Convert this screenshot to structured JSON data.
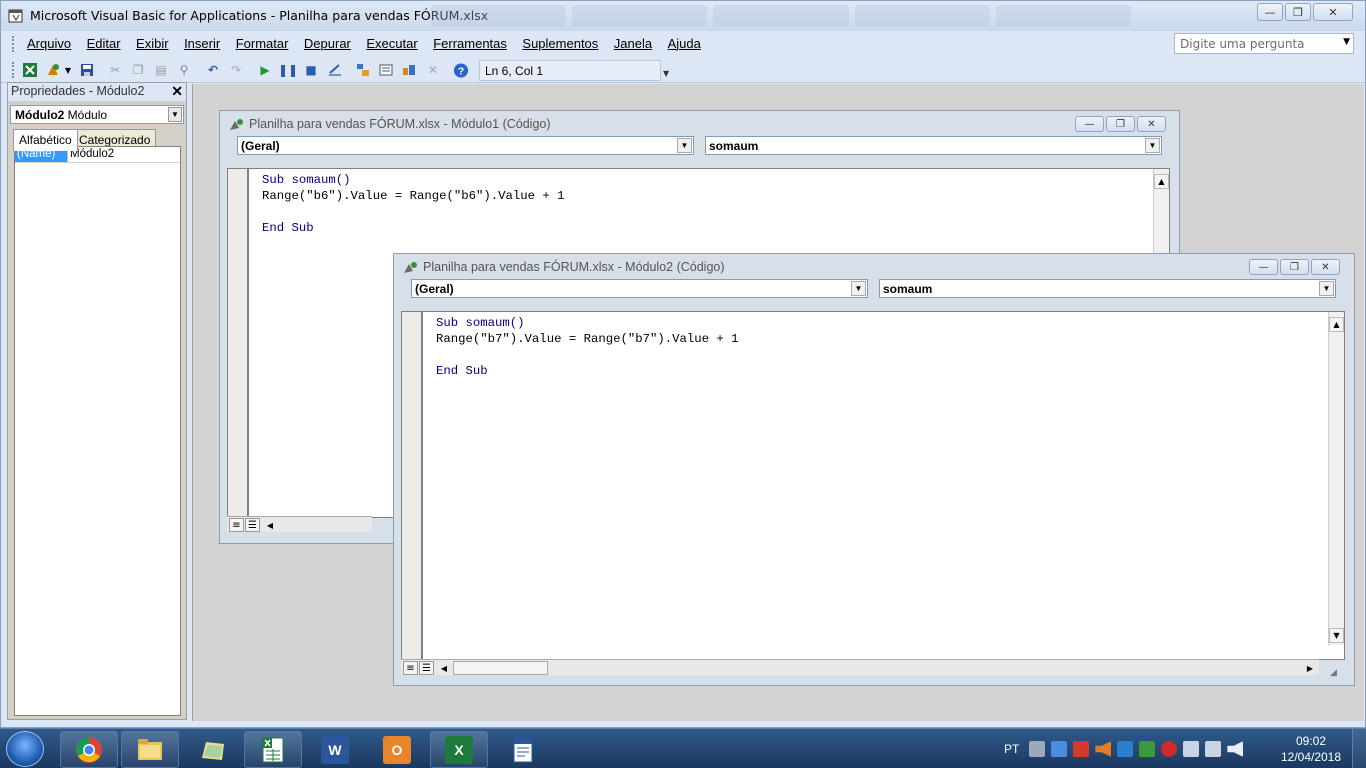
{
  "window": {
    "title": "Microsoft Visual Basic for Applications - Planilha para vendas  FÓRUM.xlsx",
    "controls": [
      "—",
      "❐",
      "✕"
    ]
  },
  "menu": {
    "items": [
      "Arquivo",
      "Editar",
      "Exibir",
      "Inserir",
      "Formatar",
      "Depurar",
      "Executar",
      "Ferramentas",
      "Suplementos",
      "Janela",
      "Ajuda"
    ]
  },
  "help": {
    "placeholder": "Digite uma pergunta"
  },
  "toolbar": {
    "position": "Ln 6, Col 1",
    "icons": [
      "excel-view-icon",
      "insert-module-icon",
      "save-icon",
      "cut-icon",
      "copy-icon",
      "paste-icon",
      "find-icon",
      "undo-icon",
      "redo-icon",
      "run-icon",
      "break-icon",
      "reset-icon",
      "design-mode-icon",
      "project-explorer-icon",
      "properties-window-icon",
      "object-browser-icon",
      "toolbox-icon",
      "help-icon"
    ]
  },
  "properties": {
    "title": "Propriedades - Módulo2",
    "object_name": "Módulo2",
    "object_type": "Módulo",
    "tabs": [
      "Alfabético",
      "Categorizado"
    ],
    "rows": [
      {
        "key": "(Name)",
        "value": "Módulo2"
      }
    ]
  },
  "code_windows": [
    {
      "title": "Planilha para vendas  FÓRUM.xlsx - Módulo1 (Código)",
      "object": "(Geral)",
      "procedure": "somaum",
      "lines": [
        "Sub somaum()",
        "Range(\"b6\").Value = Range(\"b6\").Value + 1",
        "",
        "End Sub"
      ]
    },
    {
      "title": "Planilha para vendas  FÓRUM.xlsx - Módulo2 (Código)",
      "object": "(Geral)",
      "procedure": "somaum",
      "lines": [
        "Sub somaum()",
        "Range(\"b7\").Value = Range(\"b7\").Value + 1",
        "",
        "End Sub"
      ]
    }
  ],
  "taskbar": {
    "apps": [
      {
        "name": "chrome",
        "label": ""
      },
      {
        "name": "file-explorer",
        "label": ""
      },
      {
        "name": "folder",
        "label": ""
      },
      {
        "name": "excel-sheet",
        "label": ""
      },
      {
        "name": "word",
        "label": "W"
      },
      {
        "name": "outlook",
        "label": "O"
      },
      {
        "name": "excel",
        "label": "X"
      },
      {
        "name": "document",
        "label": ""
      }
    ],
    "language": "PT",
    "time": "09:02",
    "date": "12/04/2018"
  }
}
